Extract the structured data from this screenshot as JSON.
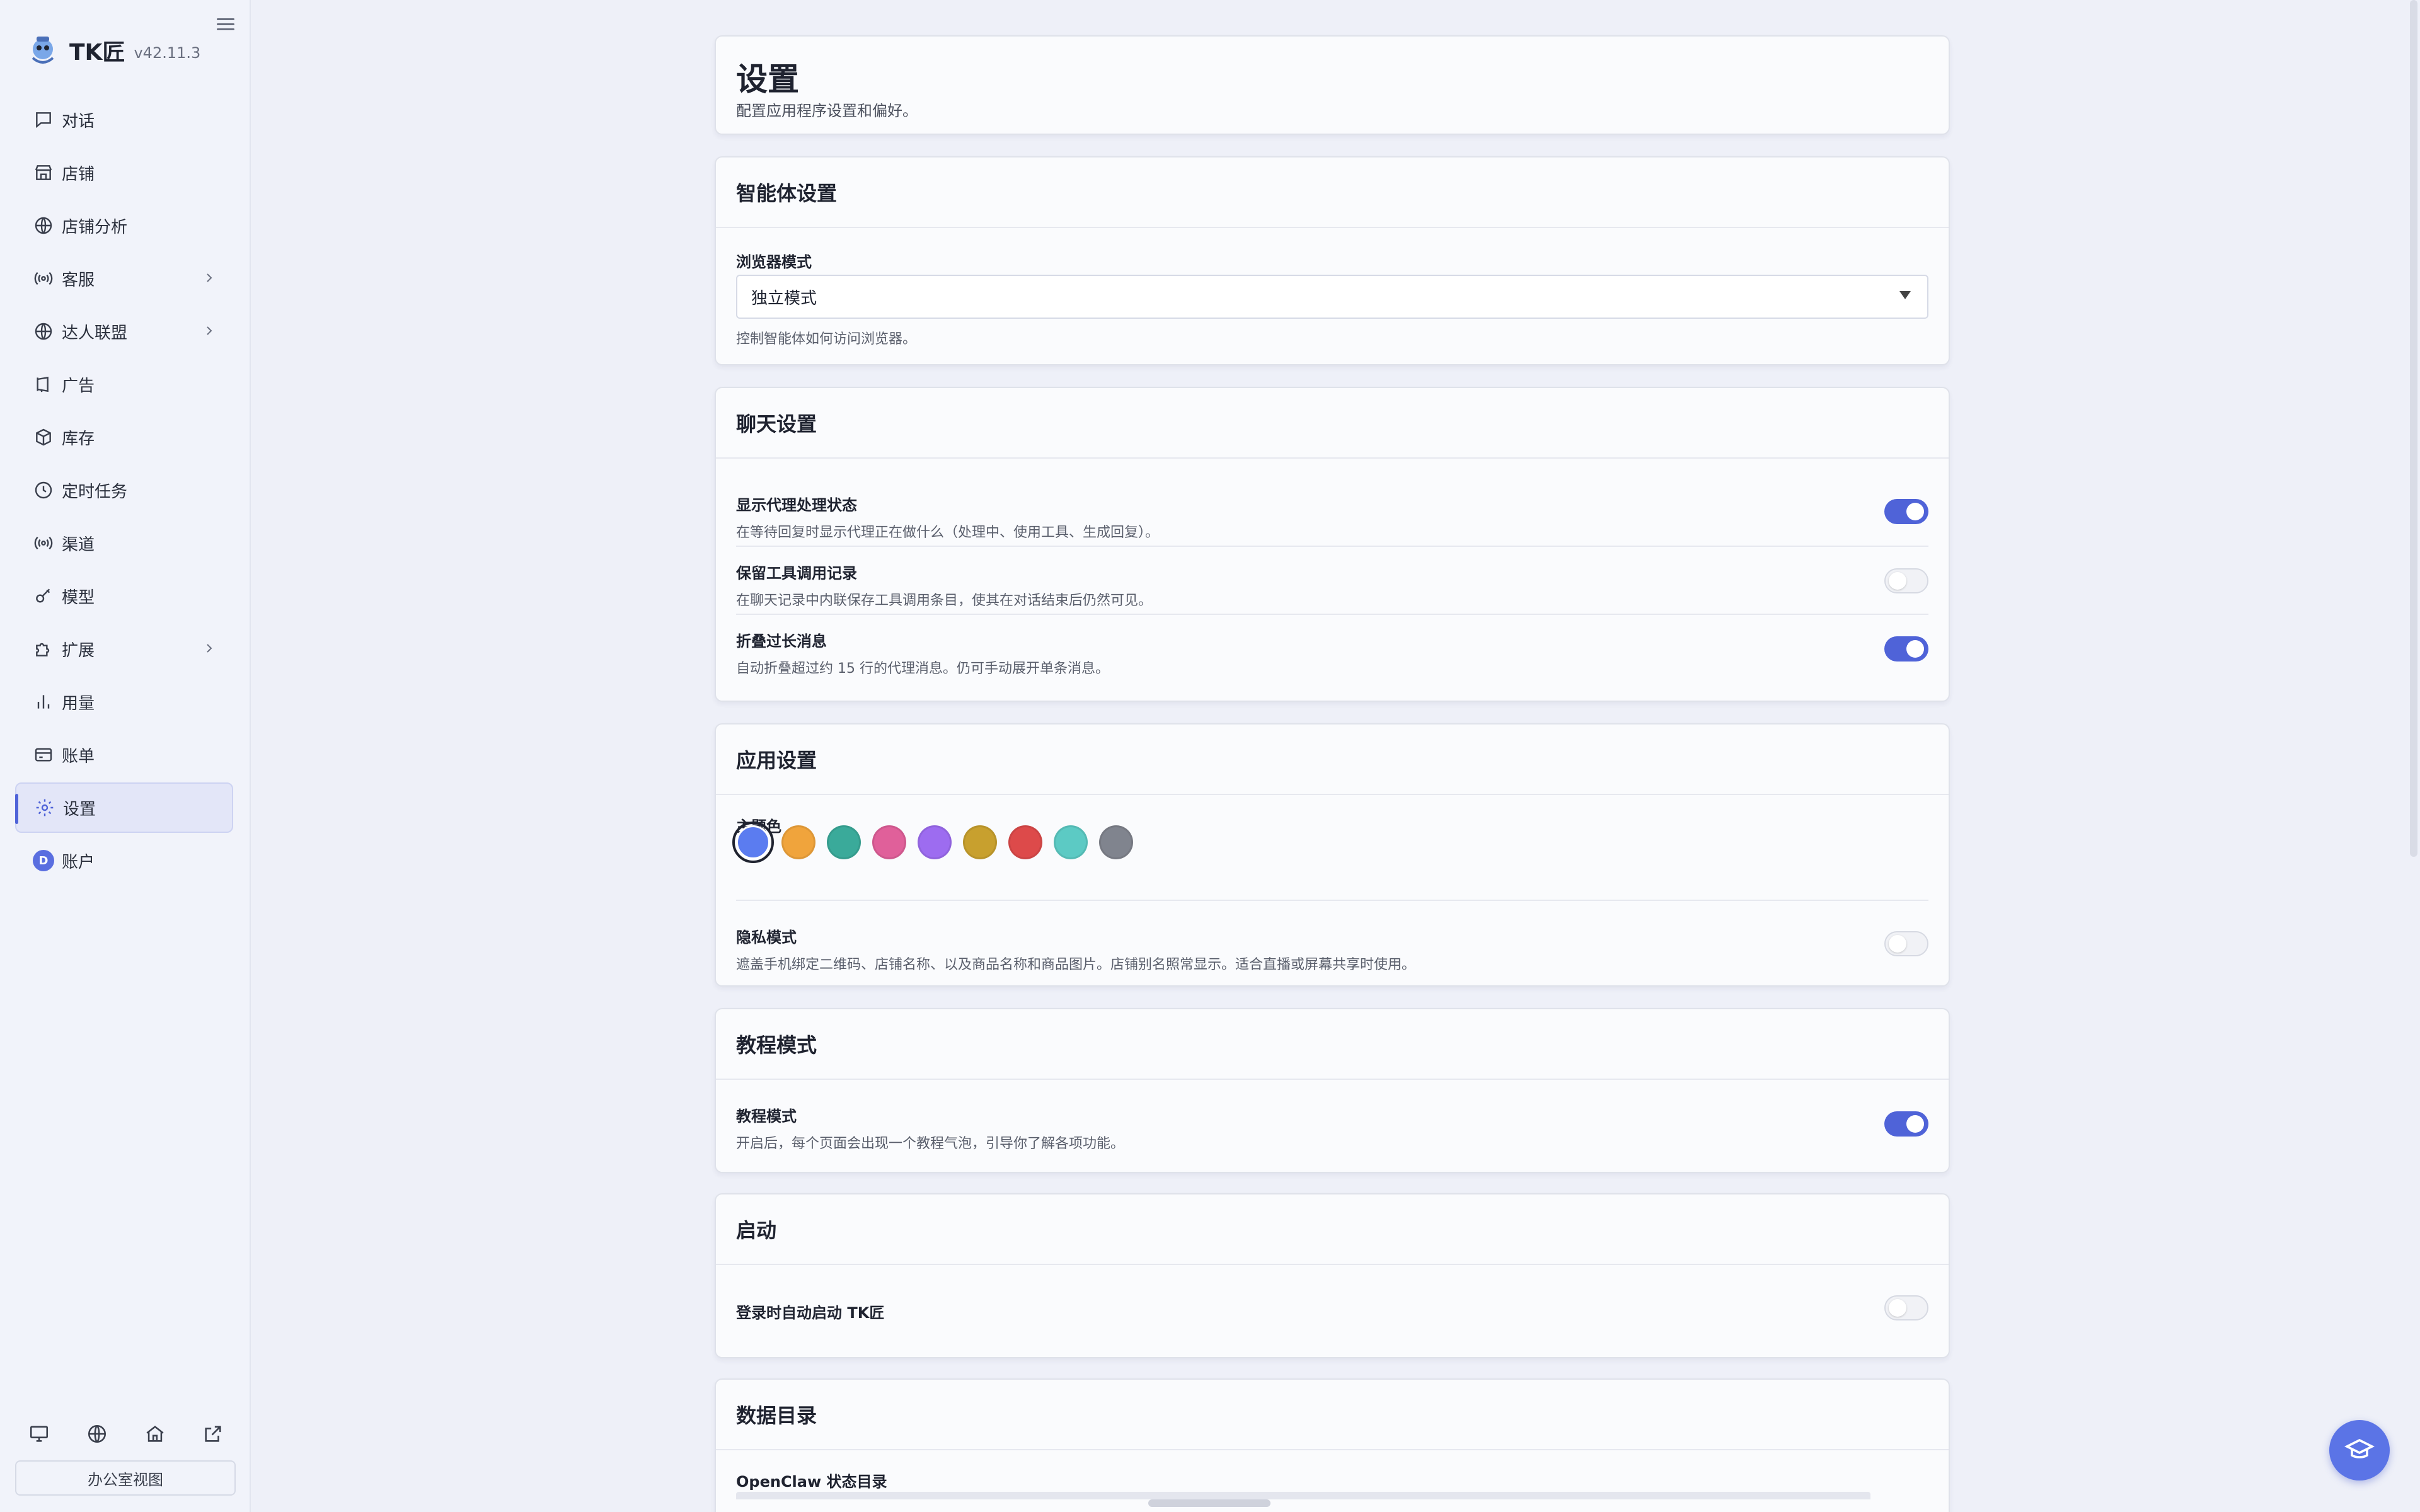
{
  "app": {
    "name": "TK匠",
    "version": "v42.11.3"
  },
  "sidebar": {
    "items": [
      {
        "label": "对话",
        "icon": "chat-icon"
      },
      {
        "label": "店铺",
        "icon": "store-icon"
      },
      {
        "label": "店铺分析",
        "icon": "globe-icon"
      },
      {
        "label": "客服",
        "icon": "broadcast-icon"
      },
      {
        "label": "达人联盟",
        "icon": "globe-icon"
      },
      {
        "label": "广告",
        "icon": "megaphone-icon"
      },
      {
        "label": "库存",
        "icon": "box-icon"
      },
      {
        "label": "定时任务",
        "icon": "clock-icon"
      },
      {
        "label": "渠道",
        "icon": "broadcast-icon"
      },
      {
        "label": "模型",
        "icon": "key-icon"
      },
      {
        "label": "扩展",
        "icon": "puzzle-icon"
      },
      {
        "label": "用量",
        "icon": "bar-chart-icon"
      },
      {
        "label": "账单",
        "icon": "card-icon"
      },
      {
        "label": "设置",
        "icon": "gear-icon",
        "active": true
      },
      {
        "label": "账户",
        "icon": "avatar",
        "avatar_letter": "D"
      }
    ],
    "office_view_label": "办公室视图"
  },
  "page": {
    "title": "设置",
    "subtitle": "配置应用程序设置和偏好。"
  },
  "agent": {
    "header": "智能体设置",
    "browser_mode_label": "浏览器模式",
    "browser_mode_value": "独立模式",
    "browser_mode_help": "控制智能体如何访问浏览器。"
  },
  "chat": {
    "header": "聊天设置",
    "rows": [
      {
        "title": "显示代理处理状态",
        "desc": "在等待回复时显示代理正在做什么（处理中、使用工具、生成回复）。",
        "on": true
      },
      {
        "title": "保留工具调用记录",
        "desc": "在聊天记录中内联保存工具调用条目，使其在对话结束后仍然可见。",
        "on": false
      },
      {
        "title": "折叠过长消息",
        "desc": "自动折叠超过约 15 行的代理消息。仍可手动展开单条消息。",
        "on": true
      }
    ]
  },
  "app_settings": {
    "header": "应用设置",
    "theme_label": "主题色",
    "theme_colors": [
      "#5b7cf0",
      "#f0a43c",
      "#3aaa9a",
      "#e0609a",
      "#9d6cf0",
      "#c8a02e",
      "#dd4a4a",
      "#5ccac4",
      "#80848e"
    ],
    "privacy_title": "隐私模式",
    "privacy_desc": "遮盖手机绑定二维码、店铺名称、以及商品名称和商品图片。店铺别名照常显示。适合直播或屏幕共享时使用。",
    "privacy_on": false
  },
  "tutorial": {
    "header": "教程模式",
    "title": "教程模式",
    "desc": "开启后，每个页面会出现一个教程气泡，引导你了解各项功能。",
    "on": true
  },
  "startup": {
    "header": "启动",
    "title": "登录时自动启动 TK匠",
    "on": false
  },
  "data_dir": {
    "header": "数据目录",
    "label": "OpenClaw 状态目录"
  },
  "colors": {
    "accent": "#4f63d8",
    "active_bg": "#e3e6f8"
  }
}
